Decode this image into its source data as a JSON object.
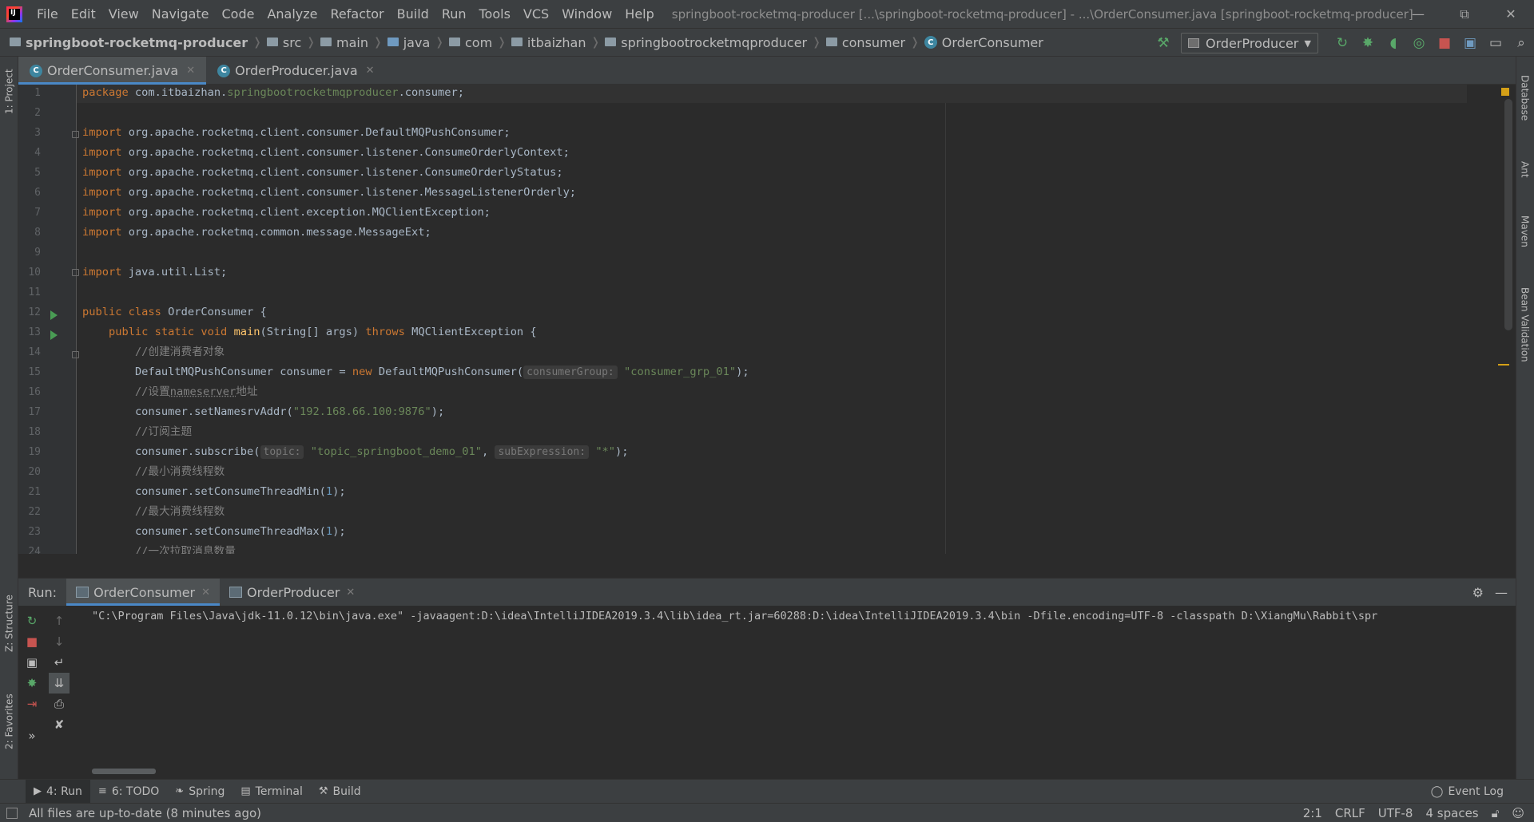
{
  "menubar": {
    "items": [
      "File",
      "Edit",
      "View",
      "Navigate",
      "Code",
      "Analyze",
      "Refactor",
      "Build",
      "Run",
      "Tools",
      "VCS",
      "Window",
      "Help"
    ],
    "title": "springboot-rocketmq-producer [...\\springboot-rocketmq-producer] - ...\\OrderConsumer.java [springboot-rocketmq-producer]"
  },
  "breadcrumb": [
    "springboot-rocketmq-producer",
    "src",
    "main",
    "java",
    "com",
    "itbaizhan",
    "springbootrocketmqproducer",
    "consumer",
    "OrderConsumer"
  ],
  "run_config": "OrderProducer",
  "left_strip": {
    "project": "1: Project",
    "structure": "Z: Structure",
    "favorites": "2: Favorites"
  },
  "right_strip": {
    "database": "Database",
    "ant": "Ant",
    "maven": "Maven",
    "bean": "Bean Validation"
  },
  "editor_tabs": [
    {
      "label": "OrderConsumer.java",
      "active": true
    },
    {
      "label": "OrderProducer.java",
      "active": false
    }
  ],
  "line_numbers": [
    "1",
    "2",
    "3",
    "4",
    "5",
    "6",
    "7",
    "8",
    "9",
    "10",
    "11",
    "12",
    "13",
    "14",
    "15",
    "16",
    "17",
    "18",
    "19",
    "20",
    "21",
    "22",
    "23",
    "24"
  ],
  "code": {
    "l1_kw": "package",
    "l1_pkg1": " com.itbaizhan.",
    "l1_pkg2": "springbootrocketmqproducer",
    "l1_pkg3": ".consumer;",
    "imp_kw": "import",
    "l3": " org.apache.rocketmq.client.consumer.DefaultMQPushConsumer;",
    "l4": " org.apache.rocketmq.client.consumer.listener.ConsumeOrderlyContext;",
    "l5": " org.apache.rocketmq.client.consumer.listener.ConsumeOrderlyStatus;",
    "l6": " org.apache.rocketmq.client.consumer.listener.MessageListenerOrderly;",
    "l7": " org.apache.rocketmq.client.exception.MQClientException;",
    "l8": " org.apache.rocketmq.common.message.MessageExt;",
    "l10": " java.util.List;",
    "l12_kw": "public class",
    "l12_rest": " OrderConsumer {",
    "l13_kw1": "public static void",
    "l13_fn": "main",
    "l13_args": "(String[] args) ",
    "l13_kw2": "throws",
    "l13_rest": " MQClientException {",
    "l14": "//创建消费者对象",
    "l15_a": "DefaultMQPushConsumer consumer = ",
    "l15_kw": "new",
    "l15_b": " DefaultMQPushConsumer(",
    "l15_hint": "consumerGroup:",
    "l15_str": "\"consumer_grp_01\"",
    "l15_end": ");",
    "l16_a": "//设置",
    "l16_b": "nameserver",
    "l16_c": "地址",
    "l17_a": "consumer.setNamesrvAddr(",
    "l17_str": "\"192.168.66.100:9876\"",
    "l17_end": ");",
    "l18": "//订阅主题",
    "l19_a": "consumer.subscribe(",
    "l19_hint1": "topic:",
    "l19_str1": "\"topic_springboot_demo_01\"",
    "l19_comma": ", ",
    "l19_hint2": "subExpression:",
    "l19_str2": "\"*\"",
    "l19_end": ");",
    "l20": "//最小消费线程数",
    "l21_a": "consumer.setConsumeThreadMin(",
    "l21_num": "1",
    "l21_end": ");",
    "l22": "//最大消费线程数",
    "l23_a": "consumer.setConsumeThreadMax(",
    "l23_num": "1",
    "l23_end": ");",
    "l24": "//一次拉取消息数量"
  },
  "run_panel": {
    "label": "Run:",
    "tabs": [
      {
        "label": "OrderConsumer",
        "active": true
      },
      {
        "label": "OrderProducer",
        "active": false
      }
    ],
    "console_line": "\"C:\\Program Files\\Java\\jdk-11.0.12\\bin\\java.exe\" -javaagent:D:\\idea\\IntelliJIDEA2019.3.4\\lib\\idea_rt.jar=60288:D:\\idea\\IntelliJIDEA2019.3.4\\bin -Dfile.encoding=UTF-8 -classpath D:\\XiangMu\\Rabbit\\spr"
  },
  "bottom_tabs": [
    "4: Run",
    "6: TODO",
    "Spring",
    "Terminal",
    "Build"
  ],
  "event_log": "Event Log",
  "status": {
    "message": "All files are up-to-date (8 minutes ago)",
    "position": "2:1",
    "line_sep": "CRLF",
    "encoding": "UTF-8",
    "indent": "4 spaces"
  }
}
